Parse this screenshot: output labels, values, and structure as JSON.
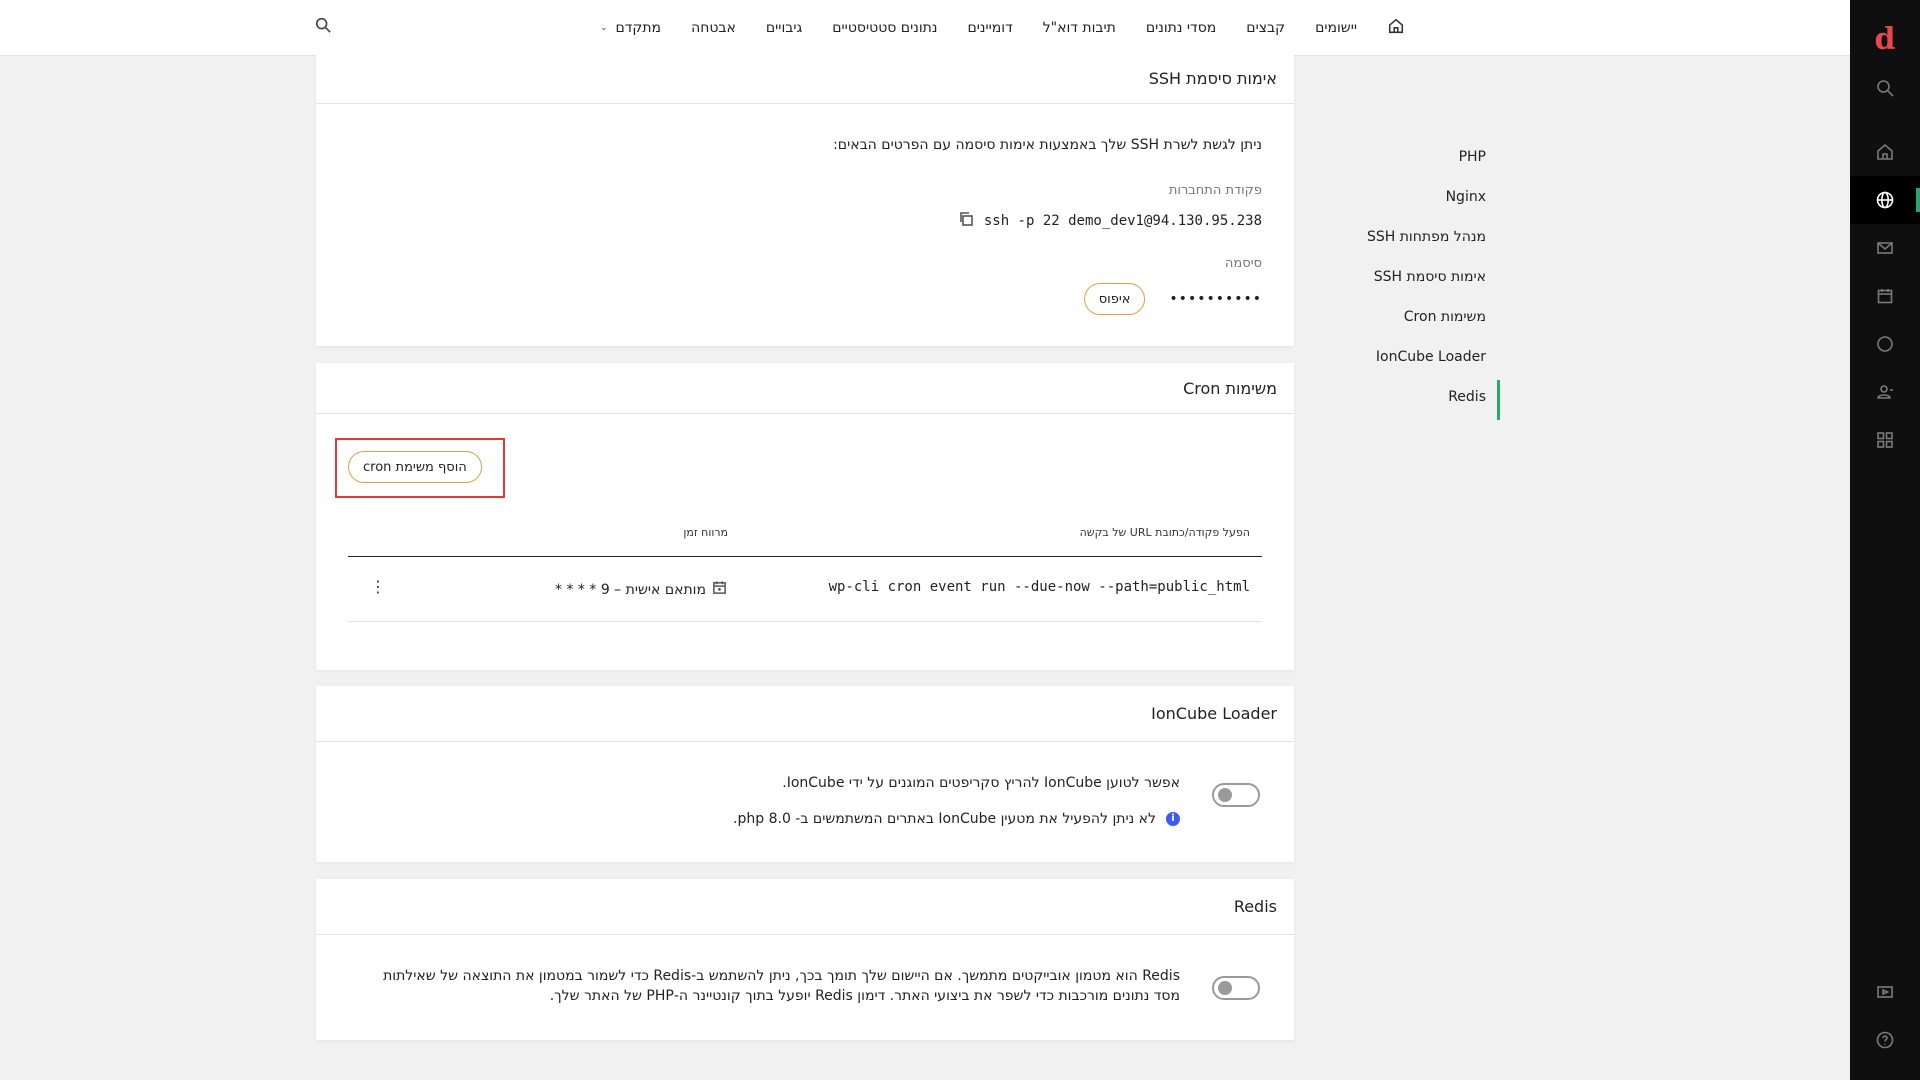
{
  "topnav": {
    "items": [
      "יישומים",
      "קבצים",
      "מסדי נתונים",
      "תיבות דוא\"ל",
      "דומיינים",
      "נתונים סטטיסטיים",
      "גיבויים",
      "אבטחה",
      "מתקדם"
    ]
  },
  "subnav": {
    "items": [
      "PHP",
      "Nginx",
      "מנהל מפתחות SSH",
      "אימות סיסמת SSH",
      "משימות Cron",
      "IonCube Loader",
      "Redis"
    ]
  },
  "ssh": {
    "title": "אימות סיסמת SSH",
    "description": "ניתן לגשת לשרת SSH שלך באמצעות אימות סיסמה עם הפרטים הבאים:",
    "command_label": "פקודת התחברות",
    "command": "ssh -p 22 demo_dev1@94.130.95.238",
    "password_label": "סיסמה",
    "password_mask": "••••••••••",
    "reset_label": "איפוס"
  },
  "cron": {
    "title": "משימות Cron",
    "add_label": "הוסף משימת cron",
    "col_command": "הפעל פקודה/כתובת URL של בקשה",
    "col_interval": "מרווח זמן",
    "rows": [
      {
        "command": "wp-cli cron event run --due-now --path=public_html",
        "interval": "מותאם אישית – 9 * * * *",
        "menu": "⋮"
      }
    ]
  },
  "ioncube": {
    "title": "IonCube Loader",
    "description": "אפשר לטוען IonCube להריץ סקריפטים המוגנים על ידי IonCube.",
    "note": "לא ניתן להפעיל את מטעין IonCube באתרים המשתמשים ב- 8.0 php.",
    "enabled": false
  },
  "redis": {
    "title": "Redis",
    "description": "Redis הוא מטמון אובייקטים מתמשך. אם היישום שלך תומך בכך, ניתן להשתמש ב-Redis כדי לשמור במטמון את התוצאה של שאילתות מסד נתונים מורכבות כדי לשפר את ביצועי האתר. דימון Redis יופעל בתוך קונטיינר ה-PHP של האתר שלך.",
    "enabled": false
  },
  "colors": {
    "accent": "#25a86b",
    "brand": "#e5484d",
    "highlight": "#e53935",
    "button_border": "#e0a04a"
  }
}
